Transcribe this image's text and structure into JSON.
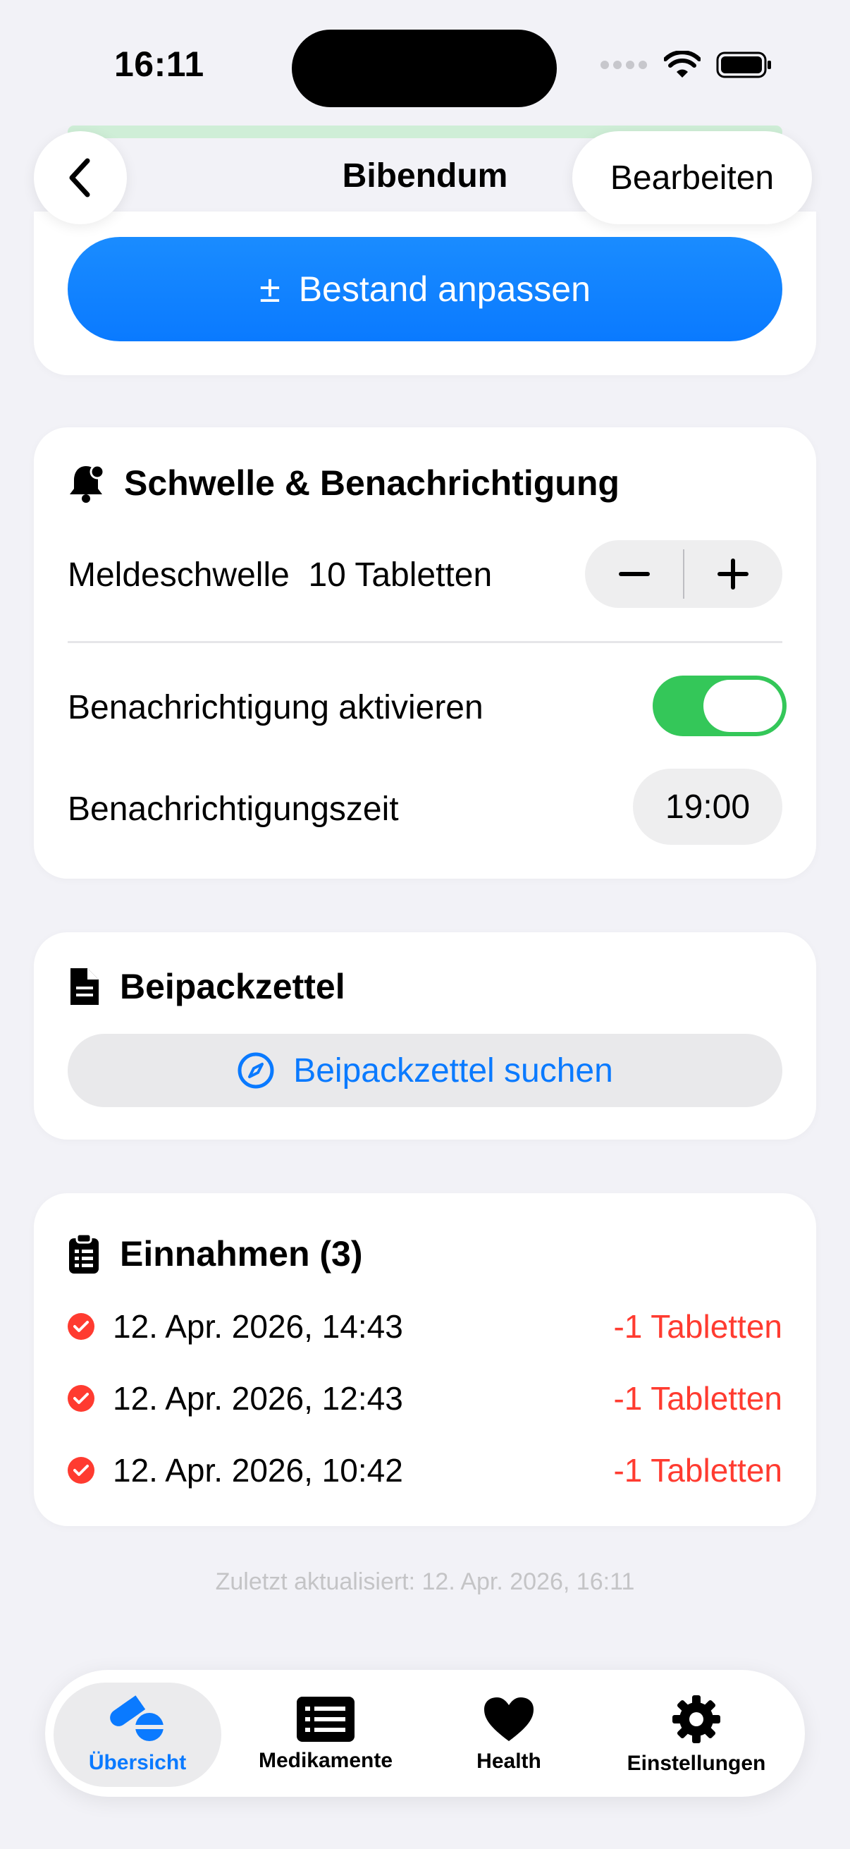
{
  "status_bar": {
    "time": "16:11"
  },
  "nav": {
    "title": "Bibendum",
    "edit_label": "Bearbeiten"
  },
  "stock": {
    "adjust_label": "Bestand anpassen"
  },
  "threshold": {
    "title": "Schwelle & Benachrichtigung",
    "threshold_label": "Meldeschwelle",
    "threshold_value": "10 Tabletten",
    "notify_label": "Benachrichtigung aktivieren",
    "notify_enabled": true,
    "time_label": "Benachrichtigungszeit",
    "time_value": "19:00"
  },
  "leaflet": {
    "title": "Beipackzettel",
    "search_label": "Beipackzettel suchen"
  },
  "intakes": {
    "title": "Einnahmen (3)",
    "items": [
      {
        "date": "12. Apr. 2026, 14:43",
        "amount": "-1 Tabletten"
      },
      {
        "date": "12. Apr. 2026, 12:43",
        "amount": "-1 Tabletten"
      },
      {
        "date": "12. Apr. 2026, 10:42",
        "amount": "-1 Tabletten"
      }
    ]
  },
  "updated": "Zuletzt aktualisiert: 12. Apr. 2026, 16:11",
  "tabs": [
    {
      "label": "Übersicht",
      "icon": "pills-icon",
      "active": true
    },
    {
      "label": "Medikamente",
      "icon": "list-icon",
      "active": false
    },
    {
      "label": "Health",
      "icon": "heart-icon",
      "active": false
    },
    {
      "label": "Einstellungen",
      "icon": "gear-icon",
      "active": false
    }
  ],
  "colors": {
    "accent": "#0a7aff",
    "toggle_on": "#34c759",
    "destructive": "#ff3b30"
  }
}
